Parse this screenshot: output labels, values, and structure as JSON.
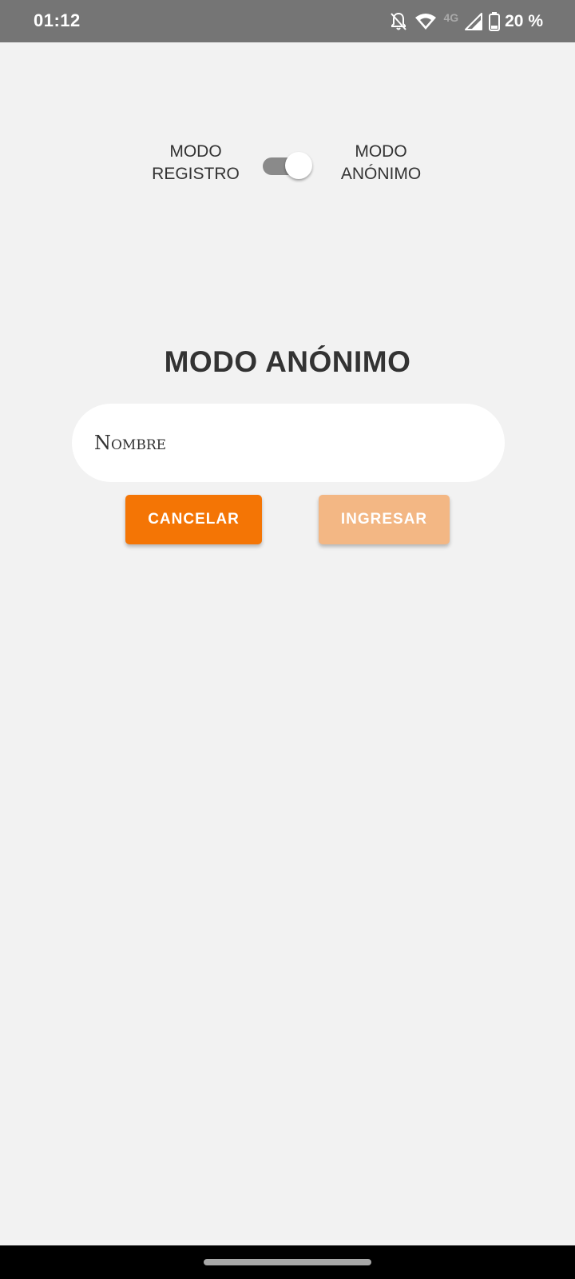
{
  "status_bar": {
    "time": "01:12",
    "network_type": "4G",
    "battery_percent": "20 %",
    "icons": [
      "notifications-off-icon",
      "wifi-icon",
      "signal-icon",
      "battery-icon"
    ]
  },
  "mode_toggle": {
    "left_label_line1": "MODO",
    "left_label_line2": "REGISTRO",
    "right_label_line1": "MODO",
    "right_label_line2": "ANÓNIMO",
    "checked": true
  },
  "main": {
    "title": "MODO ANÓNIMO",
    "name_field_placeholder": "Nombre",
    "cancel_label": "CANCELAR",
    "login_label": "INGRESAR"
  },
  "colors": {
    "background": "#f2f2f2",
    "status_bar": "#757575",
    "accent": "#f47505",
    "accent_disabled": "#f3b784",
    "text": "#333333"
  }
}
